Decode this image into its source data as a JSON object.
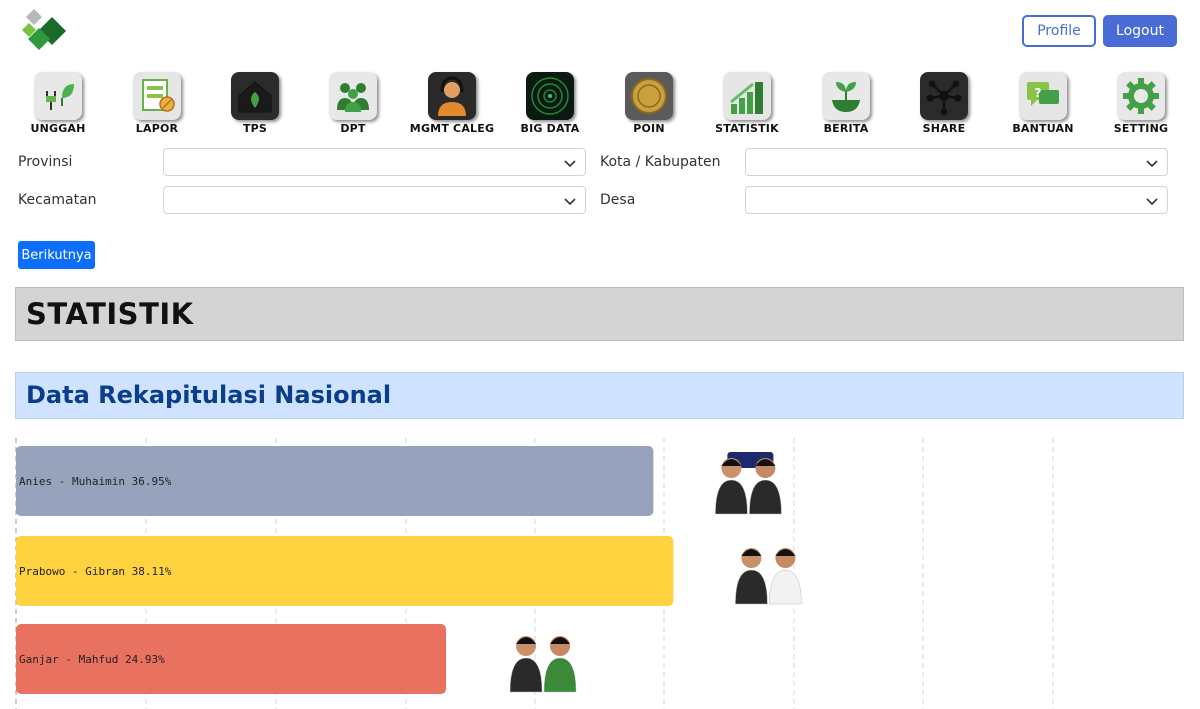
{
  "header": {
    "profile_label": "Profile",
    "logout_label": "Logout"
  },
  "menu": [
    {
      "label": "UNGGAH",
      "icon": "plug-leaf-icon"
    },
    {
      "label": "LAPOR",
      "icon": "report-icon"
    },
    {
      "label": "TPS",
      "icon": "house-leaf-icon"
    },
    {
      "label": "DPT",
      "icon": "people-group-icon"
    },
    {
      "label": "MGMT CALEG",
      "icon": "person-headset-icon"
    },
    {
      "label": "BIG DATA",
      "icon": "radar-icon"
    },
    {
      "label": "POIN",
      "icon": "coin-icon"
    },
    {
      "label": "STATISTIK",
      "icon": "bar-chart-icon"
    },
    {
      "label": "BERITA",
      "icon": "sprout-icon"
    },
    {
      "label": "SHARE",
      "icon": "share-network-icon"
    },
    {
      "label": "BANTUAN",
      "icon": "help-chat-icon"
    },
    {
      "label": "SETTING",
      "icon": "gear-icon"
    }
  ],
  "filters": {
    "provinsi_label": "Provinsi",
    "kota_label": "Kota / Kabupaten",
    "kecamatan_label": "Kecamatan",
    "desa_label": "Desa",
    "provinsi_value": "",
    "kota_value": "",
    "kecamatan_value": "",
    "desa_value": ""
  },
  "next_button_label": "Berikutnya",
  "section_title": "STATISTIK",
  "subsection_title": "Data Rekapitulasi Nasional",
  "colors": {
    "primary": "#4a6cd6",
    "button_blue": "#0d6efd",
    "amin": "#97a3bc",
    "prabowo": "#ffd340",
    "ganjar": "#e87160"
  },
  "chart_data": {
    "type": "bar",
    "orientation": "horizontal",
    "xlim": [
      0,
      45
    ],
    "grid": true,
    "categories": [
      "Anies - Muhaimin",
      "Prabowo - Gibran",
      "Ganjar - Mahfud"
    ],
    "values": [
      36.95,
      38.11,
      24.93
    ],
    "labels": [
      "Anies - Muhaimin 36.95%",
      "Prabowo - Gibran 38.11%",
      "Ganjar - Mahfud 24.93%"
    ],
    "colors": [
      "#97a3bc",
      "#ffd340",
      "#e87160"
    ]
  }
}
